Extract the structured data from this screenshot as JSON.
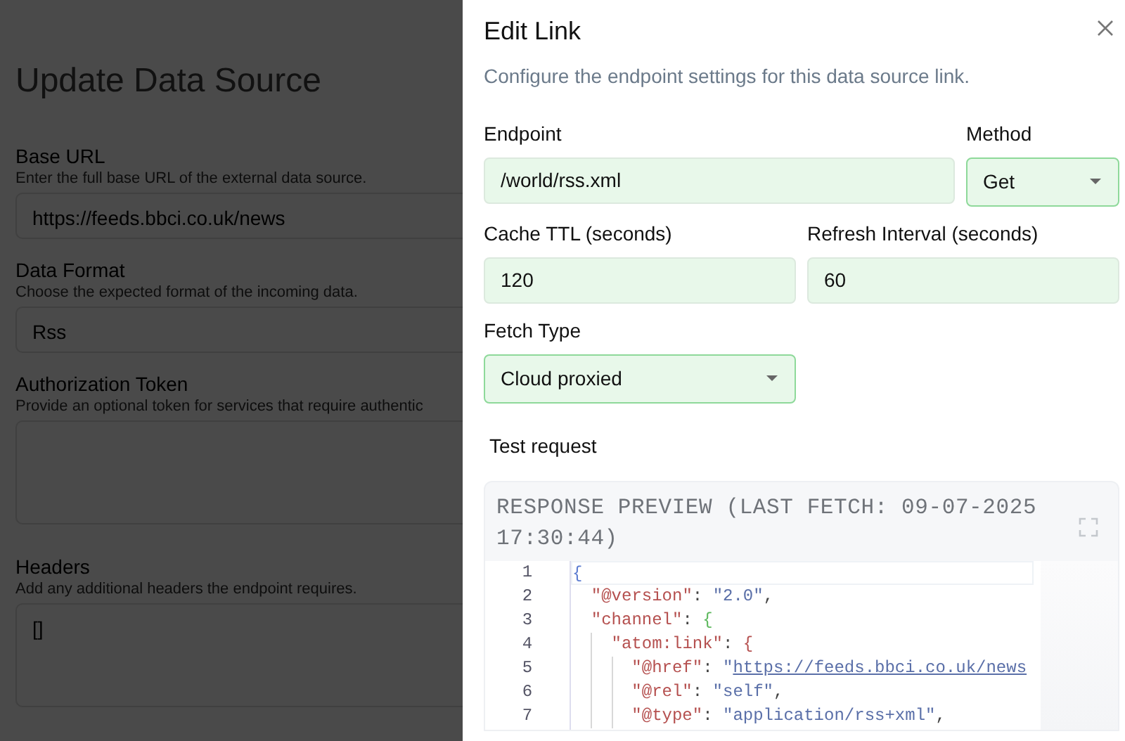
{
  "background_page": {
    "title": "Update Data Source",
    "fields": [
      {
        "label": "Base URL",
        "hint": "Enter the full base URL of the external data source.",
        "value": "https://feeds.bbci.co.uk/news",
        "kind": "input"
      },
      {
        "label": "Data Format",
        "hint": "Choose the expected format of the incoming data.",
        "value": "Rss",
        "kind": "input"
      },
      {
        "label": "Authorization Token",
        "hint": "Provide an optional token for services that require authentic",
        "kind": "textarea"
      },
      {
        "label": "Headers",
        "hint": "Add any additional headers the endpoint requires.",
        "value": "[]",
        "kind": "textarea"
      }
    ]
  },
  "dialog": {
    "title": "Edit Link",
    "description": "Configure the endpoint settings for this data source link.",
    "rows": [
      [
        {
          "label": "Endpoint",
          "value": "/world/rss.xml",
          "kind": "input"
        },
        {
          "label": "Method",
          "value": "Get",
          "kind": "select"
        }
      ],
      [
        {
          "label": "Cache TTL (seconds)",
          "value": "120",
          "kind": "input"
        },
        {
          "label": "Refresh Interval (seconds)",
          "value": "60",
          "kind": "input"
        }
      ],
      [
        {
          "label": "Fetch Type",
          "value": "Cloud proxied",
          "kind": "select"
        }
      ]
    ],
    "test_request": "Test request",
    "preview": {
      "title": "RESPONSE PREVIEW (LAST FETCH: 09-07-2025 17:30:44)",
      "lines": [
        {
          "number": "1",
          "tokens": [
            {
              "kind": "brace",
              "text": "{",
              "color": "#5b7bd0"
            }
          ]
        },
        {
          "number": "2",
          "tokens": [
            {
              "kind": "key",
              "text": "  \"@version\""
            },
            {
              "kind": "punct",
              "text": ": "
            },
            {
              "kind": "string",
              "text": "\"2.0\""
            },
            {
              "kind": "punct",
              "text": ","
            }
          ]
        },
        {
          "number": "3",
          "tokens": [
            {
              "kind": "key",
              "text": "  \"channel\""
            },
            {
              "kind": "punct",
              "text": ": "
            },
            {
              "kind": "brace",
              "text": "{",
              "color": "#5cb85c"
            }
          ]
        },
        {
          "number": "4",
          "tokens": [
            {
              "kind": "key",
              "text": "    \"atom:link\""
            },
            {
              "kind": "punct",
              "text": ": "
            },
            {
              "kind": "brace",
              "text": "{",
              "color": "#b5504f"
            }
          ]
        },
        {
          "number": "5",
          "tokens": [
            {
              "kind": "key",
              "text": "      \"@href\""
            },
            {
              "kind": "punct",
              "text": ": "
            },
            {
              "kind": "string",
              "text": "\""
            },
            {
              "kind": "link",
              "text": "https://feeds.bbci.co.uk/news"
            }
          ]
        },
        {
          "number": "6",
          "tokens": [
            {
              "kind": "key",
              "text": "      \"@rel\""
            },
            {
              "kind": "punct",
              "text": ": "
            },
            {
              "kind": "string",
              "text": "\"self\""
            },
            {
              "kind": "punct",
              "text": ","
            }
          ]
        },
        {
          "number": "7",
          "tokens": [
            {
              "kind": "key",
              "text": "      \"@type\""
            },
            {
              "kind": "punct",
              "text": ": "
            },
            {
              "kind": "string",
              "text": "\"application/rss+xml\""
            },
            {
              "kind": "punct",
              "text": ","
            }
          ]
        }
      ]
    }
  }
}
